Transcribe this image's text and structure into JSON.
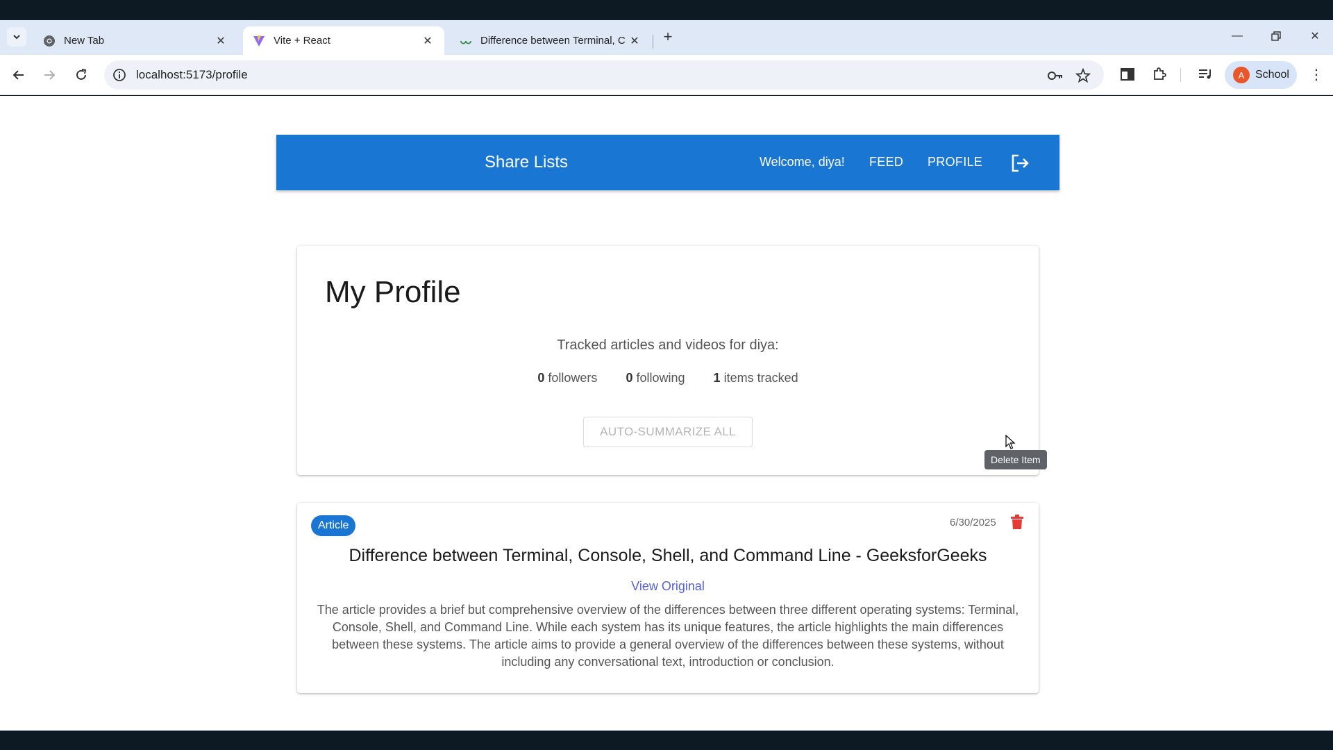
{
  "browser": {
    "tabs": [
      {
        "title": "New Tab",
        "icon": "chrome-icon"
      },
      {
        "title": "Vite + React",
        "icon": "vite-icon",
        "active": true
      },
      {
        "title": "Difference between Terminal, C",
        "icon": "geeksforgeeks-icon"
      }
    ],
    "url": "localhost:5173/profile",
    "profile_initial": "A",
    "profile_name": "School"
  },
  "appbar": {
    "brand": "Share Lists",
    "welcome": "Welcome, diya!",
    "feed": "FEED",
    "profile": "PROFILE"
  },
  "profile": {
    "heading": "My Profile",
    "tracked_label": "Tracked articles and videos for diya:",
    "followers_count": "0",
    "followers_label": "followers",
    "following_count": "0",
    "following_label": "following",
    "items_count": "1",
    "items_label": "items tracked",
    "summarize_button": "AUTO-SUMMARIZE ALL"
  },
  "items": [
    {
      "type": "Article",
      "date": "6/30/2025",
      "title": "Difference between Terminal, Console, Shell, and Command Line - GeeksforGeeks",
      "link": "View Original",
      "summary": "The article provides a brief but comprehensive overview of the differences between three different operating systems: Terminal, Console, Shell, and Command Line. While each system has its unique features, the article highlights the main differences between these systems. The article aims to provide a general overview of the differences between these systems, without including any conversational text, introduction or conclusion."
    }
  ],
  "tooltip": "Delete Item",
  "colors": {
    "primary": "#1976d2",
    "danger": "#e53935",
    "link": "#5561d6"
  }
}
